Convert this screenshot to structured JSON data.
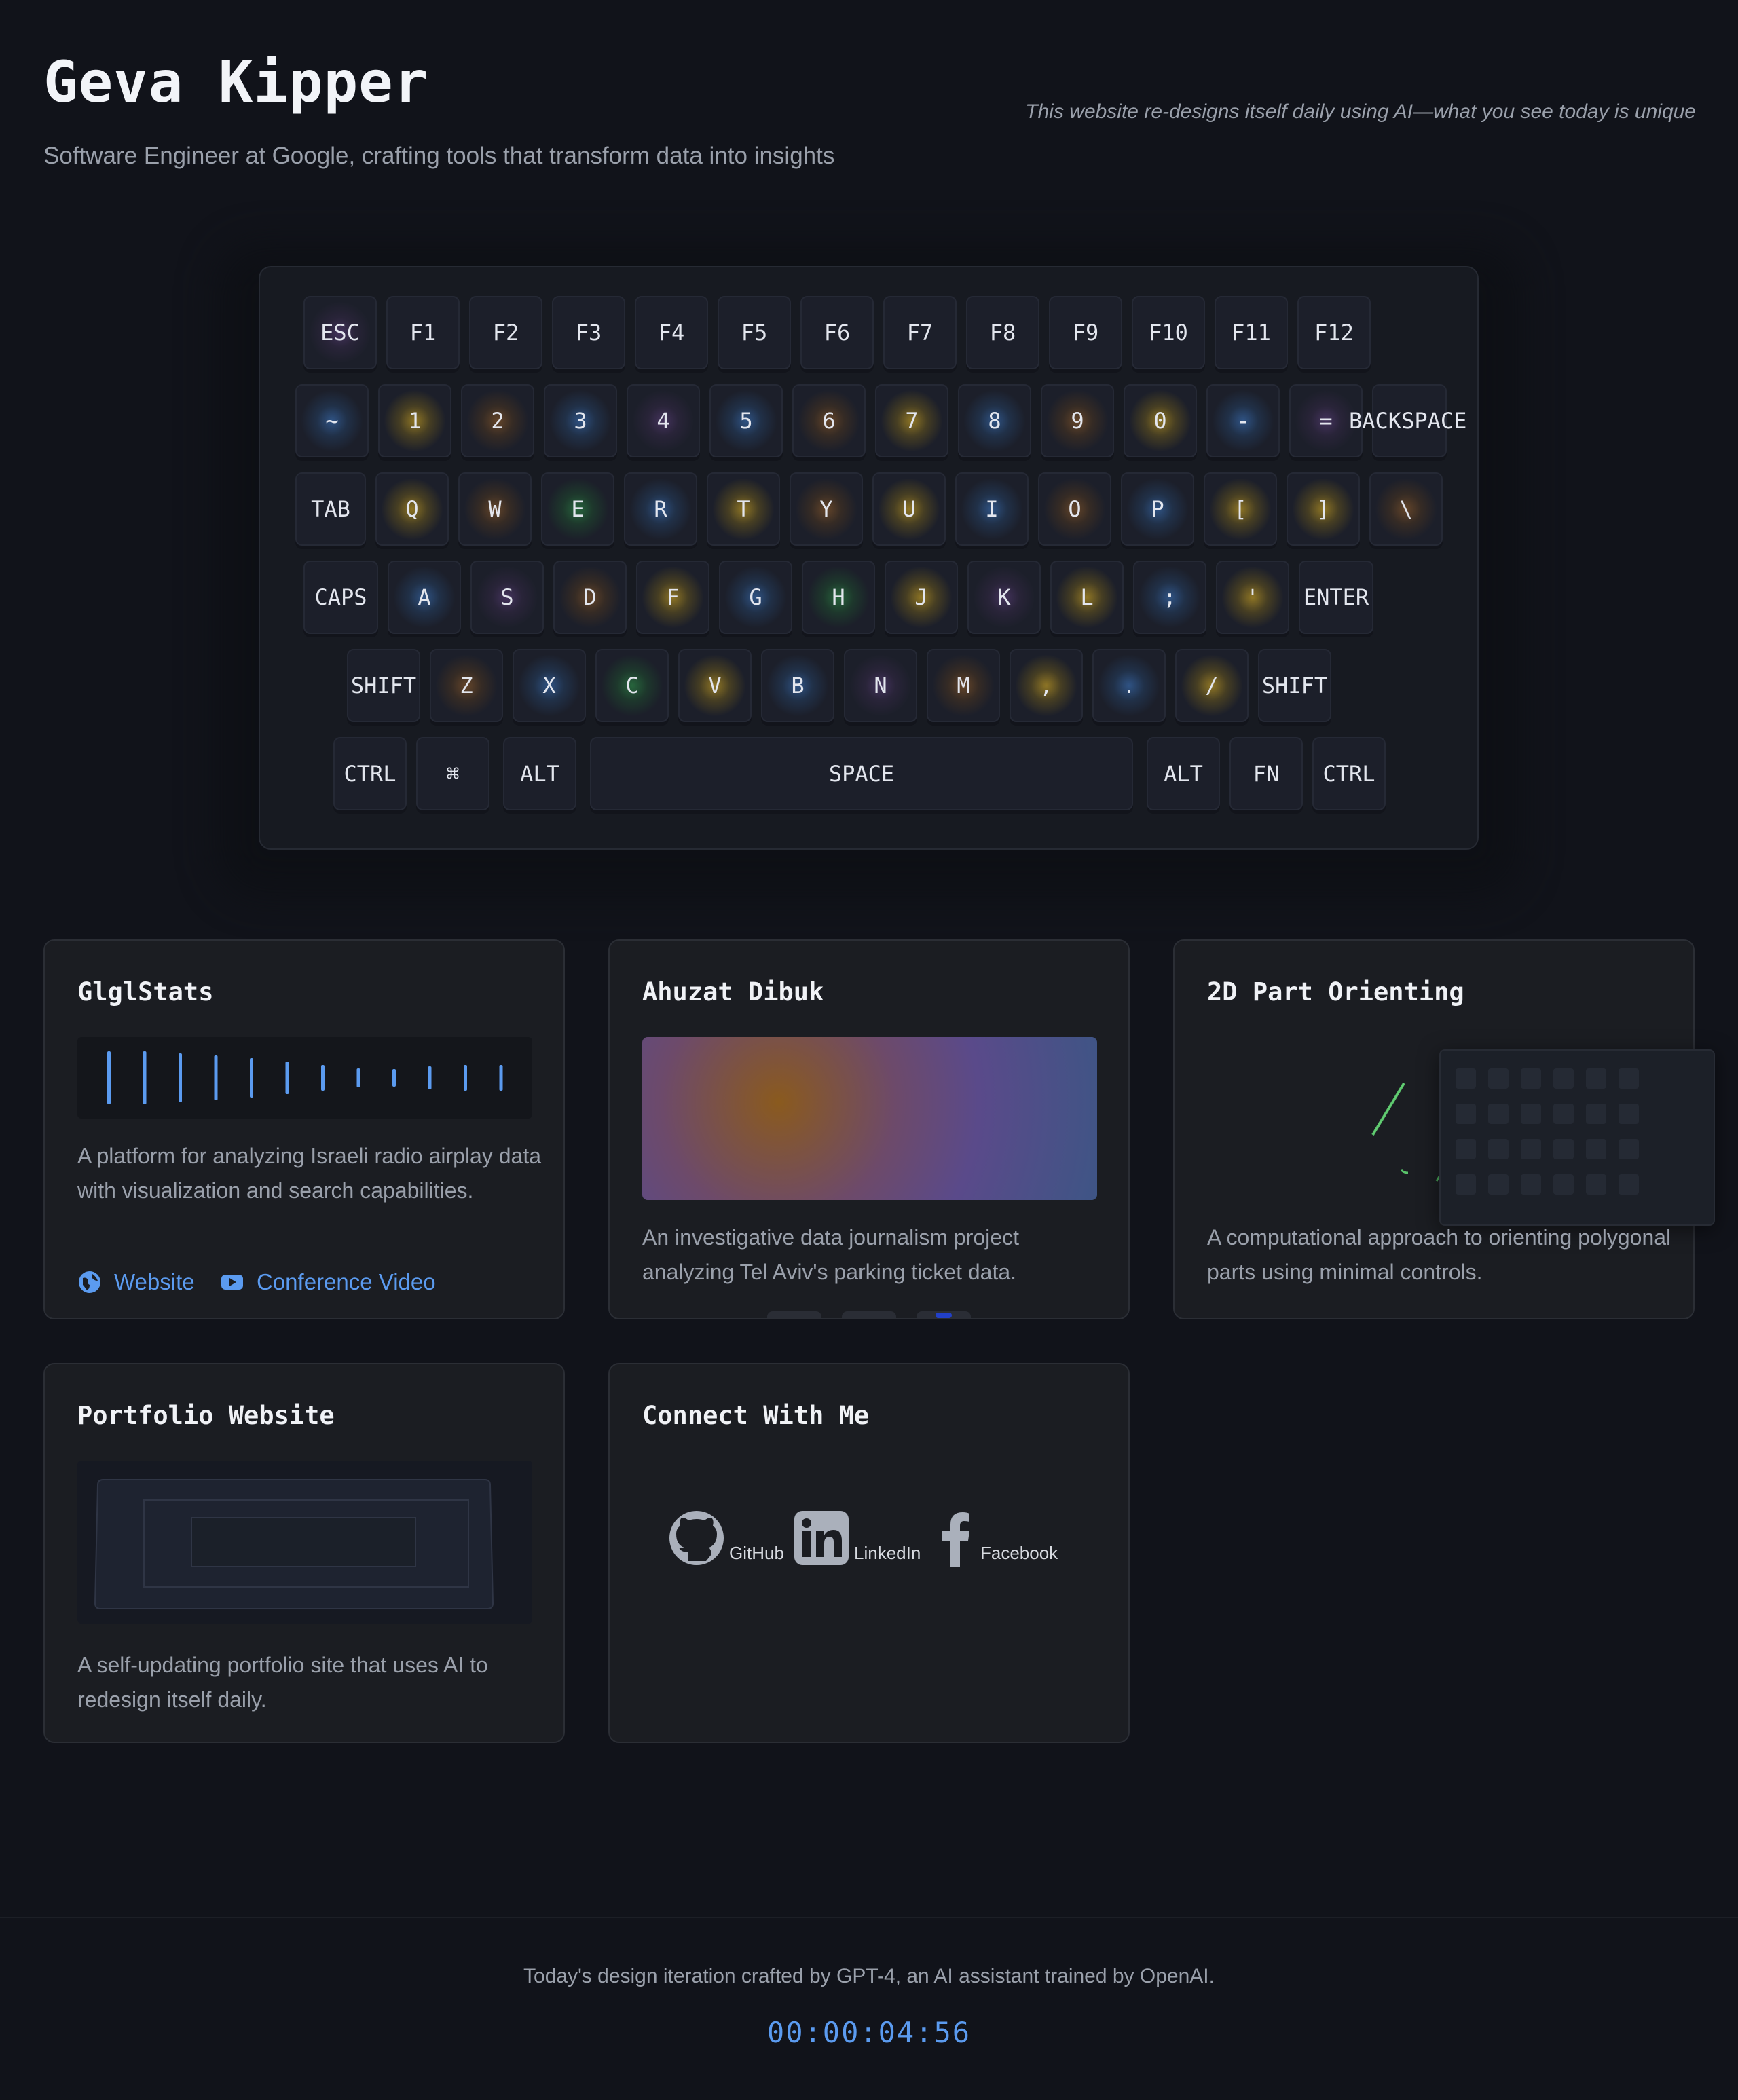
{
  "header": {
    "name": "Geva Kipper",
    "subtitle": "Software Engineer at Google, crafting tools that transform data into insights",
    "tagline": "This website re-designs itself daily using AI—what you see today is unique"
  },
  "keyboard": {
    "rows": [
      [
        "ESC",
        "F1",
        "F2",
        "F3",
        "F4",
        "F5",
        "F6",
        "F7",
        "F8",
        "F9",
        "F10",
        "F11",
        "F12"
      ],
      [
        "~",
        "1",
        "2",
        "3",
        "4",
        "5",
        "6",
        "7",
        "8",
        "9",
        "0",
        "-",
        "=",
        "BACKSPACE"
      ],
      [
        "TAB",
        "Q",
        "W",
        "E",
        "R",
        "T",
        "Y",
        "U",
        "I",
        "O",
        "P",
        "[",
        "]",
        "\\"
      ],
      [
        "CAPS",
        "A",
        "S",
        "D",
        "F",
        "G",
        "H",
        "J",
        "K",
        "L",
        ";",
        "'",
        "ENTER"
      ],
      [
        "SHIFT",
        "Z",
        "X",
        "C",
        "V",
        "B",
        "N",
        "M",
        ",",
        ".",
        "/",
        "SHIFT"
      ],
      [
        "CTRL",
        "⌘",
        "ALT",
        "SPACE",
        "ALT",
        "FN",
        "CTRL"
      ]
    ],
    "glow_colors": {
      "gold": "#c9a227",
      "blue": "#3b6fb5",
      "green": "#2f8a4a",
      "brown": "#8a5a2e",
      "purple": "#5a3f7a"
    }
  },
  "projects": [
    {
      "title": "GlglStats",
      "description": "A platform for analyzing Israeli radio airplay data with visualization and search capabilities.",
      "links": [
        {
          "label": "Website",
          "icon": "globe-icon"
        },
        {
          "label": "Conference Video",
          "icon": "youtube-icon"
        }
      ]
    },
    {
      "title": "Ahuzat Dibuk",
      "description": "An investigative data journalism project analyzing Tel Aviv's parking ticket data."
    },
    {
      "title": "2D Part Orienting",
      "description": "A computational approach to orienting polygonal parts using minimal controls."
    },
    {
      "title": "Portfolio Website",
      "description": "A self-updating portfolio site that uses AI to redesign itself daily."
    }
  ],
  "connect": {
    "title": "Connect With Me",
    "items": [
      {
        "label": "GitHub",
        "icon": "github-icon"
      },
      {
        "label": "LinkedIn",
        "icon": "linkedin-icon"
      },
      {
        "label": "Facebook",
        "icon": "facebook-icon"
      }
    ]
  },
  "footer": {
    "credit": "Today's design iteration crafted by GPT-4, an AI assistant trained by OpenAI.",
    "timer": "00:00:04:56"
  },
  "colors": {
    "accent": "#5b9bf0",
    "background": "#11131a",
    "card": "#1b1d22"
  }
}
